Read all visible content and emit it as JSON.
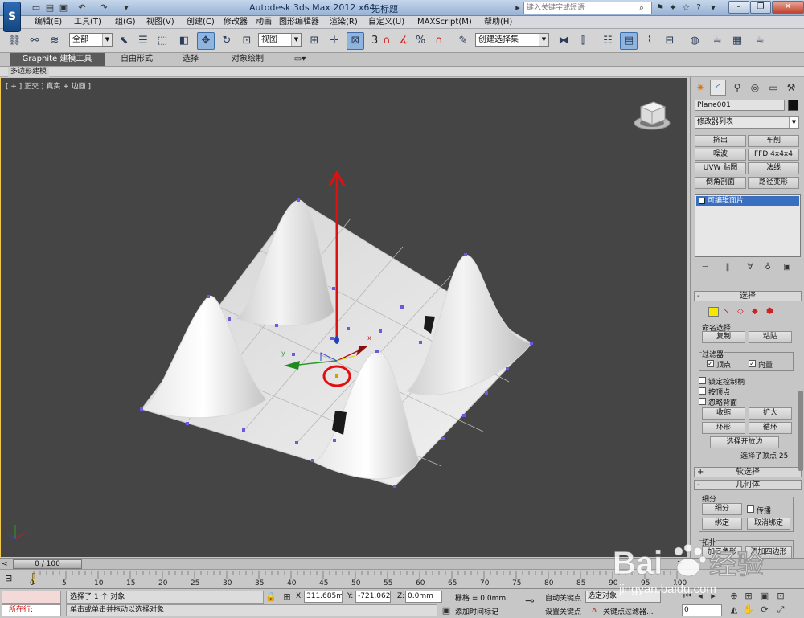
{
  "titlebar": {
    "app_title": "Autodesk 3ds Max  2012 x64",
    "doc_title": "无标题",
    "search_placeholder": "键入关键字或短语"
  },
  "menu": [
    "编辑(E)",
    "工具(T)",
    "组(G)",
    "视图(V)",
    "创建(C)",
    "修改器",
    "动画",
    "图形编辑器",
    "渲染(R)",
    "自定义(U)",
    "MAXScript(M)",
    "帮助(H)"
  ],
  "toolbar": {
    "selection_filter": "全部",
    "ref_coord": "视图",
    "snap_number": "3",
    "named_selection": "创建选择集"
  },
  "ribbon": {
    "tabs": [
      "Graphite 建模工具",
      "自由形式",
      "选择",
      "对象绘制"
    ],
    "sub_label": "多边形建模"
  },
  "viewport": {
    "label": "[ + ] 正交 ] 真实 + 边面 ]"
  },
  "command_panel": {
    "object_name": "Plane001",
    "modifier_list": "修改器列表",
    "modifier_buttons": [
      "挤出",
      "车削",
      "噪波",
      "FFD 4x4x4",
      "UVW 贴图",
      "法线",
      "倒角剖面",
      "路径变形"
    ],
    "stack_item": "可编辑面片",
    "selection_header": "选择",
    "named_selections": "命名选择:",
    "copy": "复制",
    "paste": "粘贴",
    "filter_label": "过滤器",
    "filter_vertex": "顶点",
    "filter_vector": "向量",
    "lock_handles": "锁定控制柄",
    "by_vertex": "按顶点",
    "ignore_backfacing": "忽略背面",
    "shrink": "收缩",
    "grow": "扩大",
    "ring": "环形",
    "loop": "循环",
    "select_open_edges": "选择开放边",
    "selection_status": "选择了顶点 25",
    "soft_selection": "软选择",
    "geometry": "几何体",
    "subdivision": "细分",
    "subdivide": "细分",
    "propagate": "传播",
    "bind": "绑定",
    "unbind": "取消绑定",
    "topology": "拓扑",
    "add_tri": "加三角形",
    "add_quad": "添加四边形"
  },
  "timeline": {
    "frame": "0 / 100",
    "ticks": [
      "0",
      "5",
      "10",
      "15",
      "20",
      "25",
      "30",
      "35",
      "40",
      "45",
      "50",
      "55",
      "60",
      "65",
      "70",
      "75",
      "80",
      "85",
      "90",
      "95",
      "100"
    ]
  },
  "statusbar": {
    "running": "所在行:",
    "line1": "选择了 1 个 对象",
    "line2": "单击或单击并拖动以选择对象",
    "x_label": "X:",
    "x": "311.685mm",
    "y_label": "Y:",
    "y": "-721.062m",
    "z_label": "Z:",
    "z": "0.0mm",
    "grid": "栅格 = 0.0mm",
    "add_time_tag": "添加时间标记",
    "auto_key": "自动关键点",
    "set_key": "设置关键点",
    "selected_object": "选定对象",
    "key_filters": "关键点过滤器...",
    "frame_field": "0"
  },
  "watermark": {
    "brand": "Bai",
    "brand2": "经验",
    "url": "jingyan.baidu.com"
  }
}
